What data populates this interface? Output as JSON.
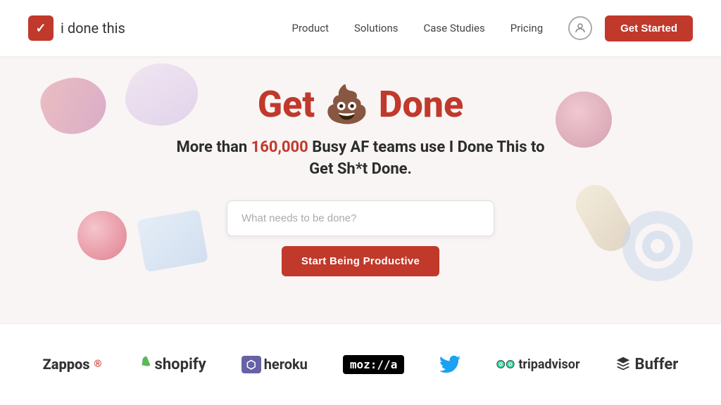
{
  "navbar": {
    "logo_icon": "✓",
    "logo_text": "i done this",
    "nav_links": [
      {
        "id": "product",
        "label": "Product"
      },
      {
        "id": "solutions",
        "label": "Solutions"
      },
      {
        "id": "case-studies",
        "label": "Case Studies"
      },
      {
        "id": "pricing",
        "label": "Pricing"
      }
    ],
    "user_icon": "👤",
    "get_started": "Get Started"
  },
  "hero": {
    "title": "Get 💩 Done",
    "subtitle_before": "More than ",
    "subtitle_highlight": "160,000",
    "subtitle_after": " Busy AF teams use I Done This to Get Sh*t Done.",
    "input_placeholder": "What needs to be done?",
    "cta_button": "Start Being Productive"
  },
  "logos": [
    {
      "id": "zappos",
      "text": "Zappos"
    },
    {
      "id": "shopify",
      "text": "shopify"
    },
    {
      "id": "heroku",
      "text": "heroku"
    },
    {
      "id": "mozilla",
      "text": "moz://a"
    },
    {
      "id": "twitter",
      "text": "🐦"
    },
    {
      "id": "tripadvisor",
      "text": "tripadvisor"
    },
    {
      "id": "buffer",
      "text": "Buffer"
    }
  ],
  "colors": {
    "brand_red": "#c0392b",
    "text_dark": "#2c2c2c",
    "bg_light": "#f9f5f4"
  }
}
